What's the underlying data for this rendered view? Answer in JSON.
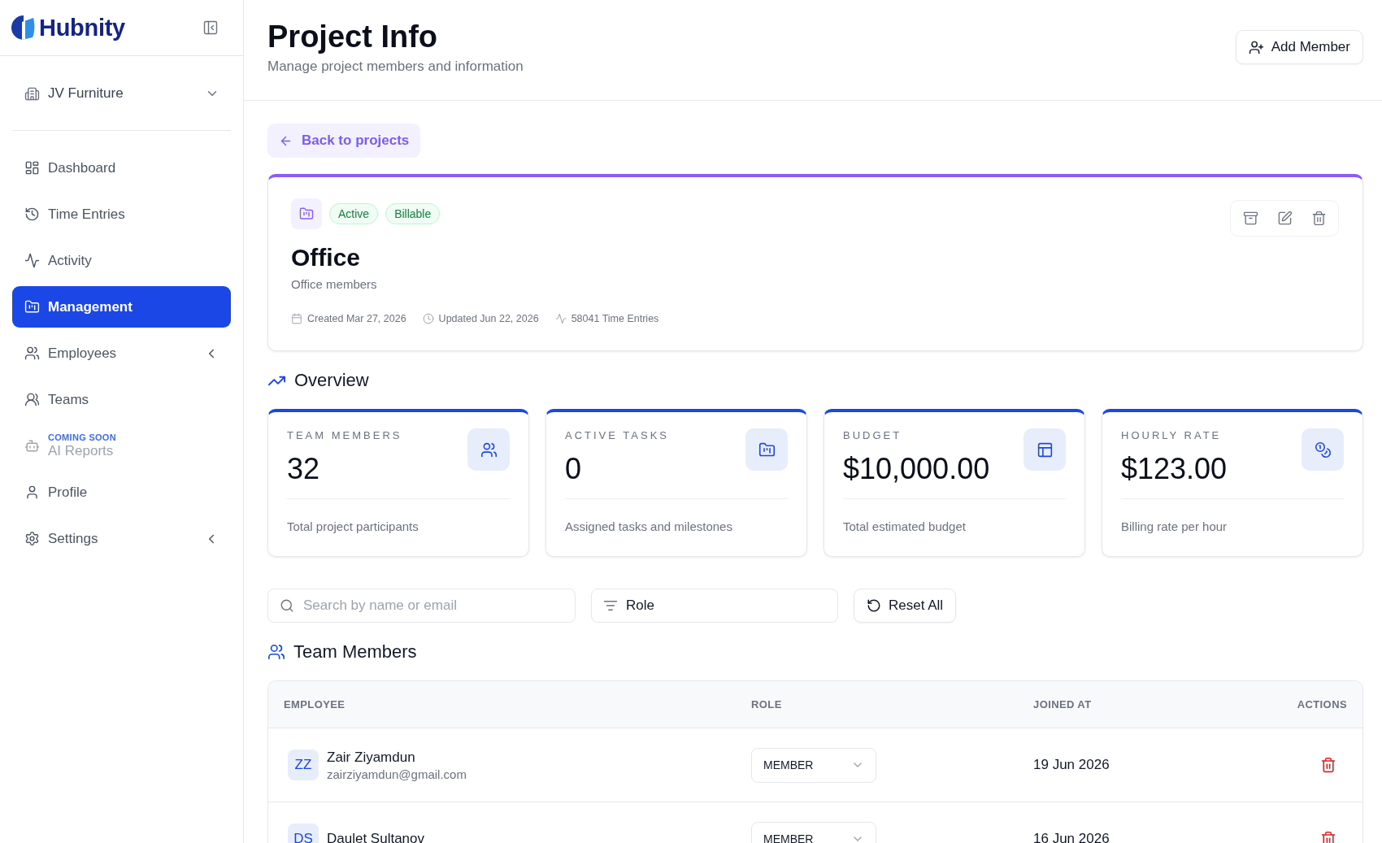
{
  "brand": {
    "name": "Hubnity"
  },
  "workspace": {
    "name": "JV Furniture"
  },
  "nav": {
    "items": [
      {
        "kind": "link",
        "label": "Dashboard",
        "selected": false
      },
      {
        "kind": "link",
        "label": "Time Entries",
        "selected": false
      },
      {
        "kind": "link",
        "label": "Activity",
        "selected": false
      },
      {
        "kind": "link",
        "label": "Management",
        "selected": true
      },
      {
        "kind": "group",
        "label": "Employees",
        "selected": false,
        "expanded": false
      },
      {
        "kind": "link",
        "label": "Teams",
        "selected": false
      },
      {
        "kind": "upcoming",
        "label": "AI Reports",
        "note": "COMING SOON",
        "selected": false
      },
      {
        "kind": "link",
        "label": "Profile",
        "selected": false
      },
      {
        "kind": "group",
        "label": "Settings",
        "selected": false,
        "expanded": false
      }
    ]
  },
  "header": {
    "title": "Project Info",
    "subtitle": "Manage project members and information",
    "action": "Add Member"
  },
  "back": {
    "label": "Back to projects"
  },
  "project": {
    "tags": [
      "Active",
      "Billable"
    ],
    "name": "Office",
    "description": "Office members",
    "meta": [
      {
        "kind": "created",
        "text": "Created Mar 27, 2026"
      },
      {
        "kind": "updated",
        "text": "Updated Jun 22, 2026"
      },
      {
        "kind": "entries",
        "text": "58041 Time Entries"
      }
    ]
  },
  "overview": {
    "title": "Overview",
    "stats": [
      {
        "label": "TEAM MEMBERS",
        "value": "32",
        "caption": "Total project participants"
      },
      {
        "label": "ACTIVE TASKS",
        "value": "0",
        "caption": "Assigned tasks and milestones"
      },
      {
        "label": "BUDGET",
        "value": "$10,000.00",
        "caption": "Total estimated budget"
      },
      {
        "label": "HOURLY RATE",
        "value": "$123.00",
        "caption": "Billing rate per hour"
      }
    ]
  },
  "filters": {
    "search": {
      "placeholder": "Search by name or email"
    },
    "role": {
      "label": "Role"
    },
    "reset": "Reset All"
  },
  "members": {
    "title": "Team Members",
    "columns": [
      "EMPLOYEE",
      "ROLE",
      "JOINED AT",
      "ACTIONS"
    ],
    "rows": [
      {
        "initials": "ZZ",
        "name": "Zair Ziyamdun",
        "email": "zairziyamdun@gmail.com",
        "role": "MEMBER",
        "joined": "19 Jun 2026"
      },
      {
        "initials": "DS",
        "name": "Daulet Sultanov",
        "role": "MEMBER",
        "joined": "16 Jun 2026"
      }
    ]
  }
}
